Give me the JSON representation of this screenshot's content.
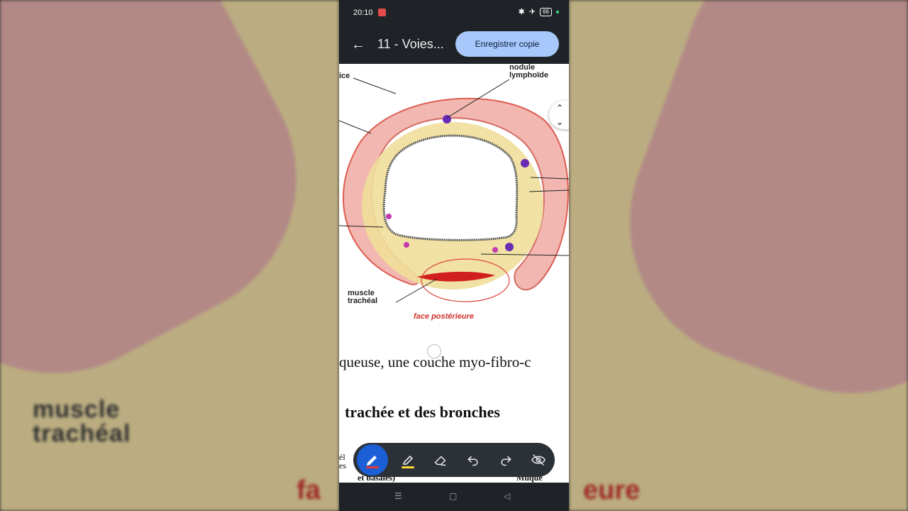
{
  "status": {
    "time": "20:10",
    "battery": "66"
  },
  "appbar": {
    "title": "11 - Voies...",
    "save_label": "Enregistrer copie"
  },
  "diagram": {
    "label_nodule": "nodule\nlymphoïde",
    "label_ice": "ice",
    "label_muscle": "muscle\ntrachéal",
    "label_face": "face postérieure"
  },
  "text": {
    "line1": "queuse, une couche myo-fibro-c",
    "heading": "trachée et des bronches",
    "partial_left": "él\nes",
    "partial_bottom": "et basales)",
    "partial_right": "Muque"
  },
  "background": {
    "muscle_label": "muscle\ntrachéal",
    "face_label": "fa          ieure"
  },
  "toolbar": {
    "tools": [
      "pen",
      "highlighter",
      "eraser",
      "undo",
      "redo",
      "hide"
    ],
    "pen_color": "#e53935",
    "highlighter_color": "#fdd835"
  },
  "colors": {
    "accent": "#a8c7fa",
    "active_tool": "#1b5ed6"
  }
}
